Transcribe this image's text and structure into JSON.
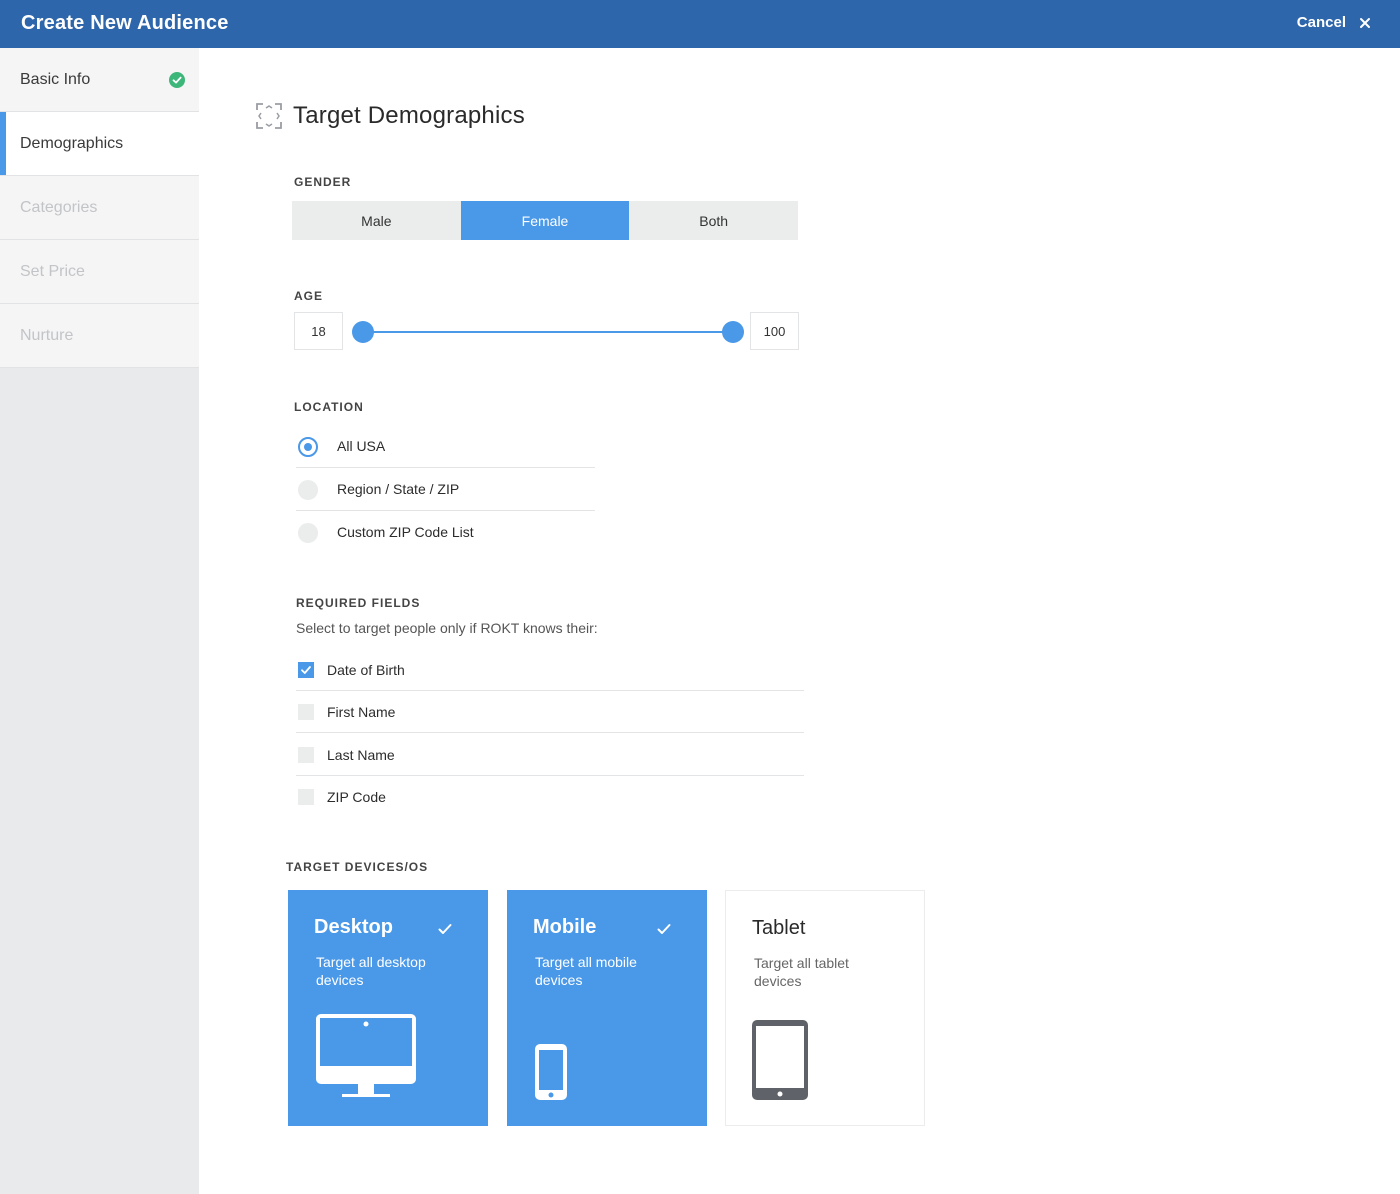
{
  "header": {
    "title": "Create New Audience",
    "cancel_label": "Cancel"
  },
  "sidebar": {
    "items": [
      {
        "label": "Basic Info",
        "state": "completed"
      },
      {
        "label": "Demographics",
        "state": "active"
      },
      {
        "label": "Categories",
        "state": "disabled"
      },
      {
        "label": "Set Price",
        "state": "disabled"
      },
      {
        "label": "Nurture",
        "state": "disabled"
      }
    ]
  },
  "main": {
    "title": "Target Demographics",
    "gender": {
      "label": "GENDER",
      "options": [
        "Male",
        "Female",
        "Both"
      ],
      "selected": "Female"
    },
    "age": {
      "label": "AGE",
      "min": "18",
      "max": "100"
    },
    "location": {
      "label": "LOCATION",
      "options": [
        "All USA",
        "Region / State / ZIP",
        "Custom ZIP Code List"
      ],
      "selected": "All USA"
    },
    "required_fields": {
      "label": "REQUIRED FIELDS",
      "hint": "Select to target people only if ROKT knows their:",
      "fields": [
        {
          "label": "Date of Birth",
          "checked": true
        },
        {
          "label": "First Name",
          "checked": false
        },
        {
          "label": "Last Name",
          "checked": false
        },
        {
          "label": "ZIP Code",
          "checked": false
        }
      ]
    },
    "devices": {
      "label": "TARGET DEVICES/OS",
      "items": [
        {
          "name": "Desktop",
          "description": "Target all desktop devices",
          "selected": true,
          "icon": "desktop-icon"
        },
        {
          "name": "Mobile",
          "description": "Target all mobile devices",
          "selected": true,
          "icon": "mobile-icon"
        },
        {
          "name": "Tablet",
          "description": "Target all tablet devices",
          "selected": false,
          "icon": "tablet-icon"
        }
      ]
    }
  },
  "colors": {
    "header": "#2e66ac",
    "accent": "#4a98e8",
    "success": "#3db67a",
    "sidebar": "#e9eaeb"
  }
}
